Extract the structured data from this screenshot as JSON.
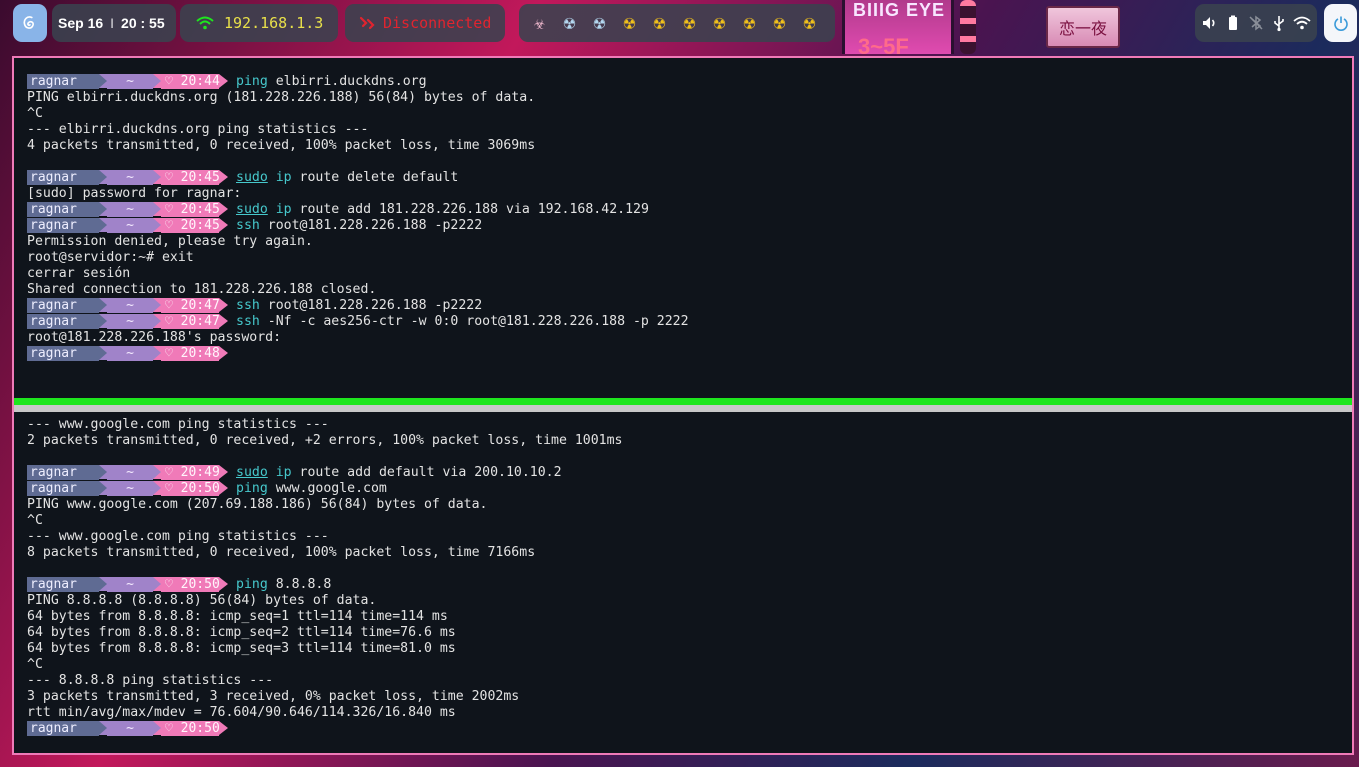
{
  "topbar": {
    "launcher_icon": "debian-swirl-icon",
    "date": "Sep 16",
    "time": "20 : 55",
    "separator": "I",
    "network_ip": "192.168.1.3",
    "vpn_status": "Disconnected",
    "workspaces": [
      "☣",
      "☢",
      "☢",
      "☢",
      "☢",
      "☢",
      "☢",
      "☢",
      "☢",
      "☢"
    ],
    "system_icons": [
      "volume-icon",
      "battery-icon",
      "bluetooth-off-icon",
      "usb-icon",
      "wifi-icon"
    ],
    "colors": {
      "ip": "#e8e04a",
      "disconnected": "#e0242f",
      "launcher": "#89b4e8"
    }
  },
  "wallpaper": {
    "sign_text": "BIIIG EYE",
    "sign_number": "3~5F",
    "small_sign_text": "恋一夜"
  },
  "prompt": {
    "user": "ragnar",
    "dir": "~",
    "heart": "♡"
  },
  "terminal": {
    "top_pane": [
      {
        "type": "prompt",
        "time": "20:44",
        "cmd": "ping",
        "args": " elbirri.duckdns.org"
      },
      {
        "type": "out",
        "text": "PING elbirri.duckdns.org (181.228.226.188) 56(84) bytes of data."
      },
      {
        "type": "out",
        "text": "^C"
      },
      {
        "type": "out",
        "text": "--- elbirri.duckdns.org ping statistics ---"
      },
      {
        "type": "out",
        "text": "4 packets transmitted, 0 received, 100% packet loss, time 3069ms"
      },
      {
        "type": "out",
        "text": ""
      },
      {
        "type": "prompt",
        "time": "20:45",
        "sudo": "sudo",
        "cmd": "ip",
        "args": " route delete default"
      },
      {
        "type": "out",
        "text": "[sudo] password for ragnar:"
      },
      {
        "type": "prompt",
        "time": "20:45",
        "sudo": "sudo",
        "cmd": "ip",
        "args": " route add 181.228.226.188 via 192.168.42.129"
      },
      {
        "type": "prompt",
        "time": "20:45",
        "cmd": "ssh",
        "args": " root@181.228.226.188 -p2222"
      },
      {
        "type": "out",
        "text": "Permission denied, please try again."
      },
      {
        "type": "out",
        "text": "root@servidor:~# exit"
      },
      {
        "type": "out",
        "text": "cerrar sesión"
      },
      {
        "type": "out",
        "text": "Shared connection to 181.228.226.188 closed."
      },
      {
        "type": "prompt",
        "time": "20:47",
        "cmd": "ssh",
        "args": " root@181.228.226.188 -p2222"
      },
      {
        "type": "prompt",
        "time": "20:47",
        "cmd": "ssh",
        "args": " -Nf -c aes256-ctr -w 0:0 root@181.228.226.188 -p 2222"
      },
      {
        "type": "out",
        "text": "root@181.228.226.188's password:"
      },
      {
        "type": "prompt",
        "time": "20:48",
        "cmd": "",
        "args": ""
      }
    ],
    "bottom_pane": [
      {
        "type": "out",
        "text": "--- www.google.com ping statistics ---"
      },
      {
        "type": "out",
        "text": "2 packets transmitted, 0 received, +2 errors, 100% packet loss, time 1001ms"
      },
      {
        "type": "out",
        "text": ""
      },
      {
        "type": "prompt",
        "time": "20:49",
        "sudo": "sudo",
        "cmd": "ip",
        "args": " route add default via 200.10.10.2"
      },
      {
        "type": "prompt",
        "time": "20:50",
        "cmd": "ping",
        "args": " www.google.com"
      },
      {
        "type": "out",
        "text": "PING www.google.com (207.69.188.186) 56(84) bytes of data."
      },
      {
        "type": "out",
        "text": "^C"
      },
      {
        "type": "out",
        "text": "--- www.google.com ping statistics ---"
      },
      {
        "type": "out",
        "text": "8 packets transmitted, 0 received, 100% packet loss, time 7166ms"
      },
      {
        "type": "out",
        "text": ""
      },
      {
        "type": "prompt",
        "time": "20:50",
        "cmd": "ping",
        "args": " 8.8.8.8"
      },
      {
        "type": "out",
        "text": "PING 8.8.8.8 (8.8.8.8) 56(84) bytes of data."
      },
      {
        "type": "out",
        "text": "64 bytes from 8.8.8.8: icmp_seq=1 ttl=114 time=114 ms"
      },
      {
        "type": "out",
        "text": "64 bytes from 8.8.8.8: icmp_seq=2 ttl=114 time=76.6 ms"
      },
      {
        "type": "out",
        "text": "64 bytes from 8.8.8.8: icmp_seq=3 ttl=114 time=81.0 ms"
      },
      {
        "type": "out",
        "text": "^C"
      },
      {
        "type": "out",
        "text": "--- 8.8.8.8 ping statistics ---"
      },
      {
        "type": "out",
        "text": "3 packets transmitted, 3 received, 0% packet loss, time 2002ms"
      },
      {
        "type": "out",
        "text": "rtt min/avg/max/mdev = 76.604/90.646/114.326/16.840 ms"
      },
      {
        "type": "prompt",
        "time": "20:50",
        "cmd": "",
        "args": ""
      }
    ]
  }
}
